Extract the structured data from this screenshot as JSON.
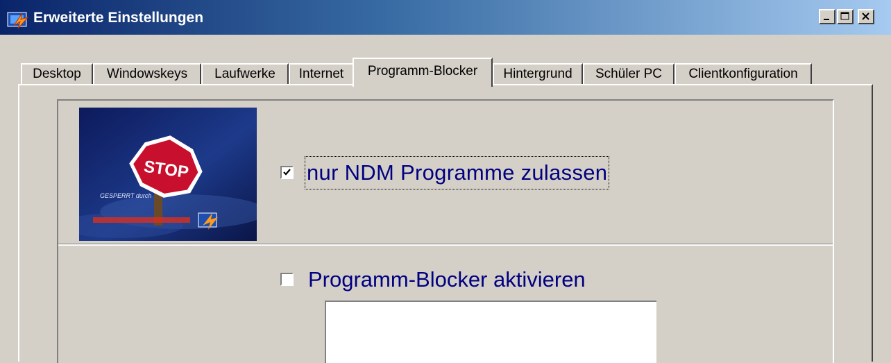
{
  "window": {
    "title": "Erweiterte Einstellungen",
    "icon": "app-icon",
    "controls": [
      "minimize-button",
      "maximize-button",
      "close-button"
    ]
  },
  "tabs": [
    {
      "label": "Desktop",
      "active": false
    },
    {
      "label": "Windowskeys",
      "active": false
    },
    {
      "label": "Laufwerke",
      "active": false
    },
    {
      "label": "Internet",
      "active": false
    },
    {
      "label": "Programm-Blocker",
      "active": true
    },
    {
      "label": "Hintergrund",
      "active": false
    },
    {
      "label": "Schüler PC",
      "active": false
    },
    {
      "label": "Clientkonfiguration",
      "active": false
    }
  ],
  "image": {
    "stop_text": "STOP",
    "blocked_text": "GESPERRT durch"
  },
  "options": {
    "ndm_only": {
      "label": "nur NDM  Programme zulassen",
      "checked": true
    },
    "blocker": {
      "label": "Programm-Blocker aktivieren",
      "checked": false
    }
  },
  "colors": {
    "label": "#000080",
    "dialog_bg": "#d4d0c8",
    "title_start": "#0a246a",
    "title_end": "#a6caf0"
  }
}
